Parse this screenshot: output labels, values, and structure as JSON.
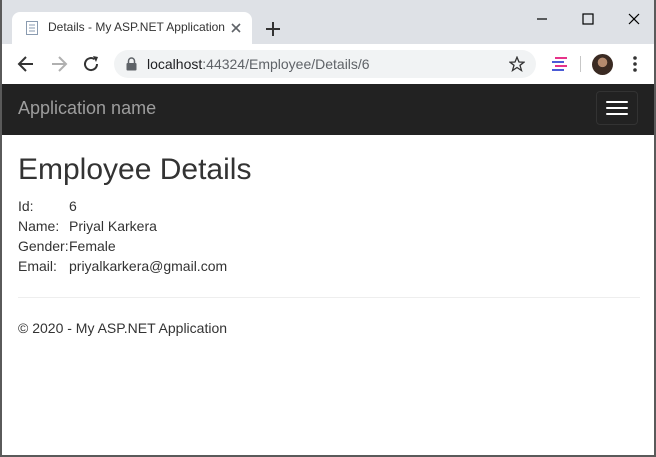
{
  "browser": {
    "tab_title": "Details - My ASP.NET Application",
    "url_host": "localhost",
    "url_rest": ":44324/Employee/Details/6"
  },
  "navbar": {
    "brand": "Application name"
  },
  "page": {
    "heading": "Employee Details",
    "fields": [
      {
        "label": "Id:",
        "value": "6"
      },
      {
        "label": "Name:",
        "value": "Priyal Karkera"
      },
      {
        "label": "Gender:",
        "value": "Female"
      },
      {
        "label": "Email:",
        "value": "priyalkarkera@gmail.com"
      }
    ],
    "footer": "© 2020 - My ASP.NET Application"
  },
  "colors": {
    "navbar_bg": "#222222",
    "brand_text": "#9d9d9d",
    "tabstrip_bg": "#dee1e6",
    "omnibox_bg": "#f1f3f4"
  },
  "icons": {
    "favicon": "document-icon",
    "tab_close": "close-icon",
    "new_tab": "plus-icon",
    "minimize": "minimize-icon",
    "maximize": "maximize-icon",
    "close_window": "close-icon",
    "back": "back-arrow-icon",
    "forward": "forward-arrow-icon",
    "reload": "reload-icon",
    "lock": "lock-icon",
    "bookmark": "star-icon",
    "extension": "extension-icon",
    "profile": "avatar",
    "menu": "kebab-menu-icon",
    "hamburger": "hamburger-icon"
  }
}
